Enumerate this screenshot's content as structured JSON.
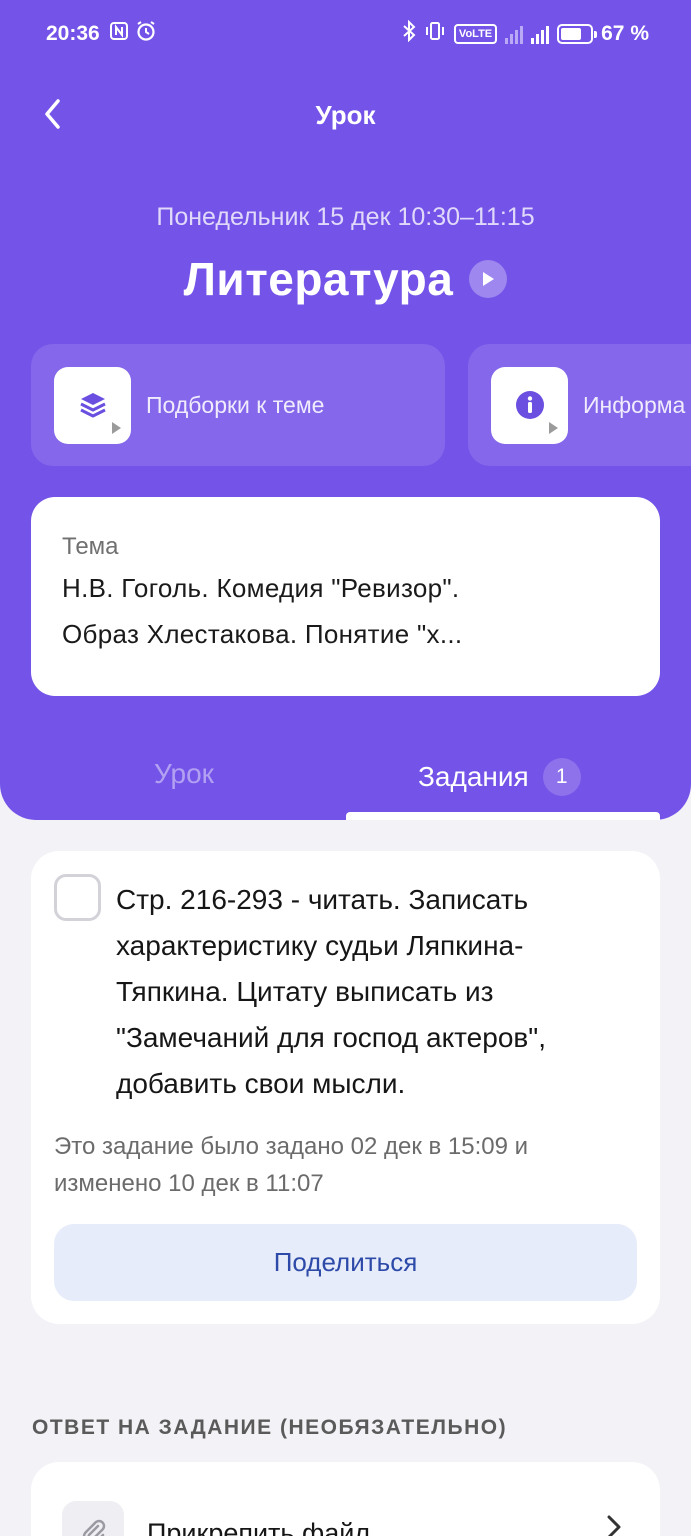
{
  "status_bar": {
    "time": "20:36",
    "battery": "67 %"
  },
  "nav": {
    "title": "Урок"
  },
  "lesson": {
    "date_time": "Понедельник 15 дек  10:30–11:15",
    "subject": "Литература"
  },
  "quick_cards": [
    {
      "label": "Подборки к теме",
      "icon": "layers-icon"
    },
    {
      "label": "Информа",
      "icon": "info-icon"
    }
  ],
  "topic": {
    "label": "Тема",
    "line1": "Н.В. Гоголь. Комедия \"Ревизор\".",
    "line2": "Образ Хлестакова. Понятие \"х..."
  },
  "tabs": {
    "lesson": "Урок",
    "tasks": "Задания",
    "tasks_badge": "1"
  },
  "task": {
    "line1": "Стр. 216-293 - читать. Записать",
    "line2": "характеристику судьи Ляпкина-",
    "line3": "Тяпкина. Цитату выписать из",
    "line4": "\"Замечаний для господ актеров\",",
    "line5": "добавить свои мысли.",
    "meta_line1": "Это задание было задано 02 дек в 15:09 и",
    "meta_line2": "изменено 10 дек в 11:07",
    "share_label": "Поделиться"
  },
  "answer": {
    "heading": "ОТВЕТ НА ЗАДАНИЕ (НЕОБЯЗАТЕЛЬНО)",
    "attach_label": "Прикрепить файл"
  },
  "colors": {
    "header_bg": "#7453e8",
    "page_bg": "#f2f2f7",
    "share_bg": "#e6ecfa",
    "share_text": "#2d4aa8"
  }
}
